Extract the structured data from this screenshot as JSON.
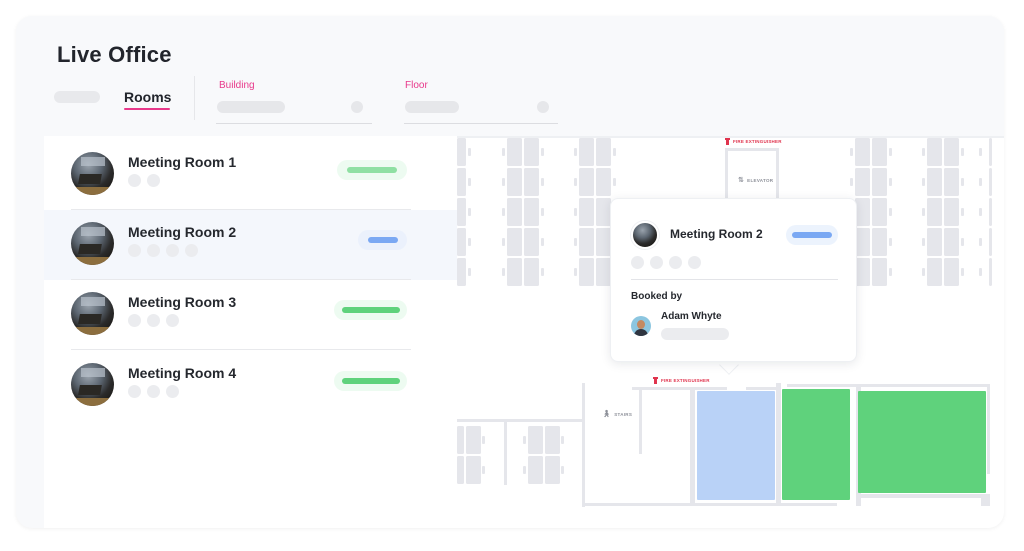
{
  "header": {
    "title": "Live Office"
  },
  "tabs": {
    "active_label": "Rooms"
  },
  "filters": {
    "building_label": "Building",
    "floor_label": "Floor"
  },
  "colors": {
    "accent": "#e8388a",
    "available": "#5fd27c",
    "available_light": "#8fe0a3",
    "booked": "#7aa8f3",
    "booked_room_fill": "#b9d2f7",
    "fire": "#e0344e"
  },
  "rooms": [
    {
      "name": "Meeting Room 1",
      "status": "available",
      "attendee_dots": 2,
      "selected": false
    },
    {
      "name": "Meeting Room 2",
      "status": "booked",
      "attendee_dots": 4,
      "selected": true
    },
    {
      "name": "Meeting Room 3",
      "status": "available",
      "attendee_dots": 3,
      "selected": false
    },
    {
      "name": "Meeting Room 4",
      "status": "available",
      "attendee_dots": 3,
      "selected": false
    }
  ],
  "map": {
    "labels": {
      "fire_extinguisher_top": "FIRE EXTINGUISHER",
      "elevator": "ELEVATOR",
      "fire_extinguisher_bottom": "FIRE EXTINGUISHER",
      "stairs": "STAIRS"
    },
    "icons": {
      "elevator": "up-down-arrows-icon",
      "stairs": "walking-person-icon",
      "fire": "fire-extinguisher-icon"
    }
  },
  "popup": {
    "room_name": "Meeting Room 2",
    "status": "booked",
    "attendee_dots": 4,
    "booked_by_label": "Booked by",
    "booked_by_name": "Adam Whyte"
  }
}
